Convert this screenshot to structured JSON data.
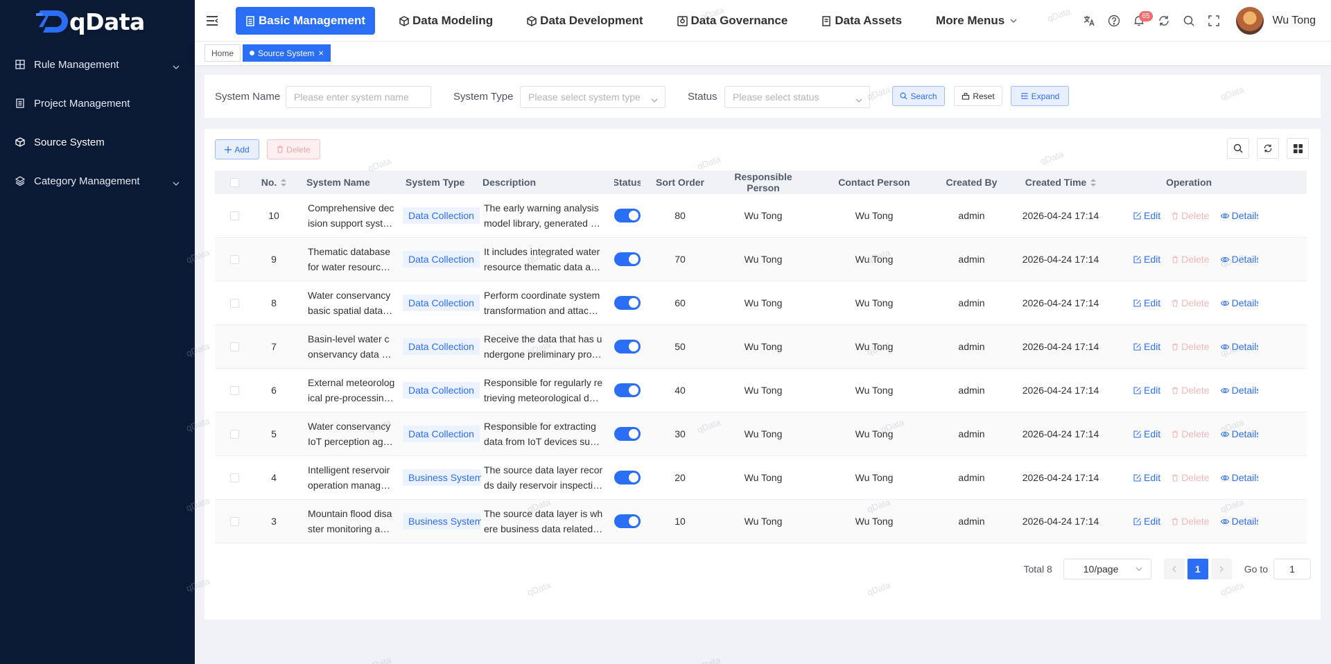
{
  "app": {
    "logo_text": "qData"
  },
  "sidebar": {
    "items": [
      {
        "label": "Rule Management",
        "icon": "grid-icon",
        "has_chevron": true
      },
      {
        "label": "Project Management",
        "icon": "document-icon",
        "has_chevron": false
      },
      {
        "label": "Source System",
        "icon": "cube-icon",
        "has_chevron": false
      },
      {
        "label": "Category Management",
        "icon": "layers-icon",
        "has_chevron": true
      }
    ]
  },
  "topnav": {
    "items": [
      {
        "label": "Basic Management",
        "active": true
      },
      {
        "label": "Data Modeling",
        "active": false
      },
      {
        "label": "Data Development",
        "active": false
      },
      {
        "label": "Data Governance",
        "active": false
      },
      {
        "label": "Data Assets",
        "active": false
      },
      {
        "label": "More Menus",
        "active": false
      }
    ],
    "notification_count": "65",
    "user_name": "Wu Tong"
  },
  "tags": {
    "home": "Home",
    "current": "Source System"
  },
  "search": {
    "system_name_label": "System Name",
    "system_name_placeholder": "Please enter system name",
    "system_type_label": "System Type",
    "system_type_placeholder": "Please select system type",
    "status_label": "Status",
    "status_placeholder": "Please select status",
    "search_button": "Search",
    "reset_button": "Reset",
    "expand_button": "Expand"
  },
  "toolbar": {
    "add_button": "Add",
    "delete_button": "Delete"
  },
  "table": {
    "columns": {
      "no": "No.",
      "system_name": "System Name",
      "system_type": "System Type",
      "description": "Description",
      "status": "Status",
      "sort_order": "Sort Order",
      "responsible": "Responsible Person",
      "contact": "Contact Person",
      "created_by": "Created By",
      "created_time": "Created Time",
      "operation": "Operation"
    },
    "op_labels": {
      "edit": "Edit",
      "delete": "Delete",
      "details": "Details"
    },
    "rows": [
      {
        "no": "10",
        "name1": "Comprehensive dec",
        "name2": "ision support syst…",
        "type": "Data Collection",
        "desc1": "The early warning analysis",
        "desc2": "model library, generated …",
        "status_on": true,
        "sort": "80",
        "responsible": "Wu Tong",
        "contact": "Wu Tong",
        "created_by": "admin",
        "created_time": "2026-04-24 17:14"
      },
      {
        "no": "9",
        "name1": "Thematic database",
        "name2": "for water resourc…",
        "type": "Data Collection",
        "desc1": "It includes integrated water",
        "desc2": "resource thematic data a…",
        "status_on": true,
        "sort": "70",
        "responsible": "Wu Tong",
        "contact": "Wu Tong",
        "created_by": "admin",
        "created_time": "2026-04-24 17:14"
      },
      {
        "no": "8",
        "name1": "Water conservancy",
        "name2": "basic spatial data…",
        "type": "Data Collection",
        "desc1": "Perform coordinate system",
        "desc2": "transformation and attac…",
        "status_on": true,
        "sort": "60",
        "responsible": "Wu Tong",
        "contact": "Wu Tong",
        "created_by": "admin",
        "created_time": "2026-04-24 17:14"
      },
      {
        "no": "7",
        "name1": "Basin-level water c",
        "name2": "onservancy data …",
        "type": "Data Collection",
        "desc1": "Receive the data that has u",
        "desc2": "ndergone preliminary pro…",
        "status_on": true,
        "sort": "50",
        "responsible": "Wu Tong",
        "contact": "Wu Tong",
        "created_by": "admin",
        "created_time": "2026-04-24 17:14"
      },
      {
        "no": "6",
        "name1": "External meteorolog",
        "name2": "ical pre-processin…",
        "type": "Data Collection",
        "desc1": "Responsible for regularly re",
        "desc2": "trieving meteorological d…",
        "status_on": true,
        "sort": "40",
        "responsible": "Wu Tong",
        "contact": "Wu Tong",
        "created_by": "admin",
        "created_time": "2026-04-24 17:14"
      },
      {
        "no": "5",
        "name1": "Water conservancy",
        "name2": "IoT perception ag…",
        "type": "Data Collection",
        "desc1": "Responsible for extracting",
        "desc2": "data from IoT devices su…",
        "status_on": true,
        "sort": "30",
        "responsible": "Wu Tong",
        "contact": "Wu Tong",
        "created_by": "admin",
        "created_time": "2026-04-24 17:14"
      },
      {
        "no": "4",
        "name1": "Intelligent reservoir",
        "name2": "operation manag…",
        "type": "Business System",
        "desc1": "The source data layer recor",
        "desc2": "ds daily reservoir inspecti…",
        "status_on": true,
        "sort": "20",
        "responsible": "Wu Tong",
        "contact": "Wu Tong",
        "created_by": "admin",
        "created_time": "2026-04-24 17:14"
      },
      {
        "no": "3",
        "name1": "Mountain flood disa",
        "name2": "ster monitoring a…",
        "type": "Business System",
        "desc1": "The source data layer is wh",
        "desc2": "ere business data related…",
        "status_on": true,
        "sort": "10",
        "responsible": "Wu Tong",
        "contact": "Wu Tong",
        "created_by": "admin",
        "created_time": "2026-04-24 17:14"
      }
    ]
  },
  "pagination": {
    "total_text": "Total 8",
    "page_size": "10/page",
    "current_page": "1",
    "goto_label": "Go to",
    "goto_value": "1"
  },
  "watermark": "qData",
  "colors": {
    "primary": "#2b6ef6",
    "sidebar_bg": "#0b1a34",
    "danger_light": "#f7b6b6"
  }
}
